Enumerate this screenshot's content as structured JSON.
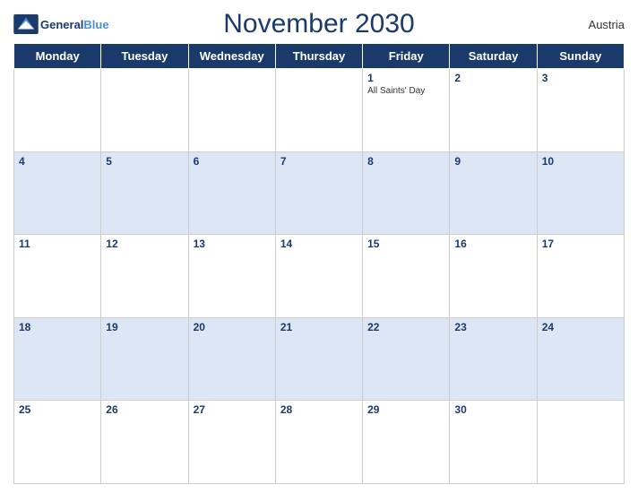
{
  "header": {
    "title": "November 2030",
    "country": "Austria",
    "logo": {
      "general": "General",
      "blue": "Blue"
    }
  },
  "weekdays": [
    "Monday",
    "Tuesday",
    "Wednesday",
    "Thursday",
    "Friday",
    "Saturday",
    "Sunday"
  ],
  "weeks": [
    [
      {
        "day": "",
        "holiday": ""
      },
      {
        "day": "",
        "holiday": ""
      },
      {
        "day": "",
        "holiday": ""
      },
      {
        "day": "",
        "holiday": ""
      },
      {
        "day": "1",
        "holiday": "All Saints' Day"
      },
      {
        "day": "2",
        "holiday": ""
      },
      {
        "day": "3",
        "holiday": ""
      }
    ],
    [
      {
        "day": "4",
        "holiday": ""
      },
      {
        "day": "5",
        "holiday": ""
      },
      {
        "day": "6",
        "holiday": ""
      },
      {
        "day": "7",
        "holiday": ""
      },
      {
        "day": "8",
        "holiday": ""
      },
      {
        "day": "9",
        "holiday": ""
      },
      {
        "day": "10",
        "holiday": ""
      }
    ],
    [
      {
        "day": "11",
        "holiday": ""
      },
      {
        "day": "12",
        "holiday": ""
      },
      {
        "day": "13",
        "holiday": ""
      },
      {
        "day": "14",
        "holiday": ""
      },
      {
        "day": "15",
        "holiday": ""
      },
      {
        "day": "16",
        "holiday": ""
      },
      {
        "day": "17",
        "holiday": ""
      }
    ],
    [
      {
        "day": "18",
        "holiday": ""
      },
      {
        "day": "19",
        "holiday": ""
      },
      {
        "day": "20",
        "holiday": ""
      },
      {
        "day": "21",
        "holiday": ""
      },
      {
        "day": "22",
        "holiday": ""
      },
      {
        "day": "23",
        "holiday": ""
      },
      {
        "day": "24",
        "holiday": ""
      }
    ],
    [
      {
        "day": "25",
        "holiday": ""
      },
      {
        "day": "26",
        "holiday": ""
      },
      {
        "day": "27",
        "holiday": ""
      },
      {
        "day": "28",
        "holiday": ""
      },
      {
        "day": "29",
        "holiday": ""
      },
      {
        "day": "30",
        "holiday": ""
      },
      {
        "day": "",
        "holiday": ""
      }
    ]
  ]
}
